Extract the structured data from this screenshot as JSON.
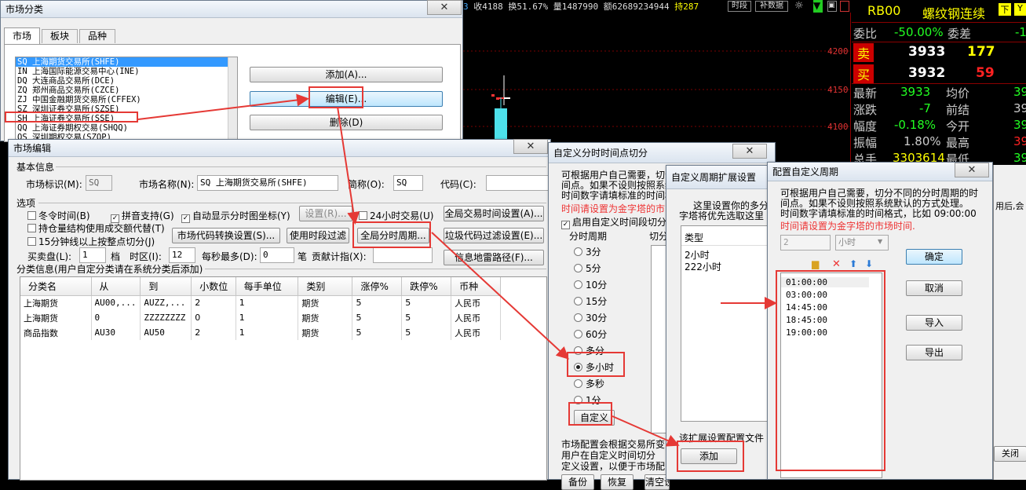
{
  "ticker": {
    "items": [
      "3",
      "收4188",
      "换51.67%",
      "量1487990",
      "额62689234944",
      "持287"
    ],
    "btn1": "时段",
    "btn2": "补数据"
  },
  "quote": {
    "code": "RB00",
    "name": "螺纹钢连续",
    "btn_x": "下",
    "btn_y": "Y",
    "rows": [
      {
        "l1": "委比",
        "v1": "-50.00%",
        "l2": "委差",
        "v2": "-1"
      },
      {
        "l1": "卖",
        "v1": "3933",
        "l2": "",
        "v2": "177"
      },
      {
        "l1": "买",
        "v1": "3932",
        "l2": "",
        "v2": "59"
      },
      {
        "l1": "最新",
        "v1": "3933",
        "l2": "均价",
        "v2": "39"
      },
      {
        "l1": "涨跌",
        "v1": "-7",
        "l2": "前结",
        "v2": "39"
      },
      {
        "l1": "幅度",
        "v1": "-0.18%",
        "l2": "今开",
        "v2": "39"
      },
      {
        "l1": "振幅",
        "v1": "1.80%",
        "l2": "最高",
        "v2": "39"
      },
      {
        "l1": "总手",
        "v1": "3303614",
        "l2": "最低",
        "v2": "39"
      }
    ],
    "price_ticks": [
      "4200",
      "4150",
      "4100"
    ]
  },
  "market_cls": {
    "title": "市场分类",
    "tabs": [
      "市场",
      "板块",
      "品种"
    ],
    "list": [
      "SQ 上海期货交易所(SHFE)",
      "IN 上海国际能源交易中心(INE)",
      "DQ 大连商品交易所(DCE)",
      "ZQ 郑州商品交易所(CZCE)",
      "ZJ 中国金融期货交易所(CFFEX)",
      "SZ 深圳证券交易所(SZSE)",
      "SH 上海证券交易所(SSE)",
      "QQ 上海证券期权交易(SHQQ)",
      "OS 深圳期权交易(SZOP)"
    ],
    "btn_add": "添加(A)...",
    "btn_edit": "编辑(E)...",
    "btn_del": "删除(D)"
  },
  "market_edit": {
    "title": "市场编辑",
    "basic": "基本信息",
    "id_label": "市场标识(M):",
    "id_val": "SQ",
    "name_label": "市场名称(N):",
    "name_val": "SQ 上海期货交易所(SHFE)",
    "short_label": "简称(O):",
    "short_val": "SQ",
    "code_label": "代码(C):",
    "options": "选项",
    "cb": [
      "冬令时间(B)",
      "拼音支持(G)",
      "自动显示分时图坐标(Y)",
      "持仓量结构使用成交额代替(T)",
      "15分钟线以上按整点切分(J)",
      "24小时交易(U)"
    ],
    "settings_btn": "设置(R)...",
    "btn_global_trade": "全局交易时间设置(A)...",
    "btn_code_conv": "市场代码转换设置(S)...",
    "btn_time_filter": "使用时段过滤",
    "btn_global_period": "全局分时周期...",
    "btn_junk": "垃圾代码过滤设置(E)...",
    "btn_info": "信息地雷路径(F)...",
    "buy_label": "买卖盘(L):",
    "buy_val": "1",
    "dang": "档",
    "tz_label": "时区(I):",
    "tz_val": "12",
    "max_label": "每秒最多(D):",
    "max_val": "0",
    "bi": "笔",
    "contrib": "贡献计指(X):",
    "cat_info": "分类信息(用户自定分类请在系统分类后添加)",
    "headers": [
      "分类名",
      "从",
      "到",
      "小数位",
      "每手单位",
      "类别",
      "涨停%",
      "跌停%",
      "币种"
    ],
    "rows": [
      [
        "上海期货",
        "AU00,...",
        "AUZZ,...",
        "2",
        "1",
        "期货",
        "5",
        "5",
        "人民币"
      ],
      [
        "上海期货",
        "0",
        "ZZZZZZZZ",
        "0",
        "1",
        "期货",
        "5",
        "5",
        "人民币"
      ],
      [
        "商品指数",
        "AU30",
        "AU50",
        "2",
        "1",
        "期货",
        "5",
        "5",
        "人民币"
      ]
    ]
  },
  "time_split": {
    "title": "自定义分时时间点切分",
    "desc1": "可根据用户自己需要，切分不",
    "desc2": "间点。如果不设则按照系统默",
    "desc3": "时间数字请填标准的时间格式",
    "red": "时间请设置为金字塔的市",
    "enable": "启用自定义时间段切分",
    "period": "分时周期",
    "cut": "切分",
    "radios": [
      "3分",
      "5分",
      "10分",
      "15分",
      "30分",
      "60分",
      "多分",
      "多小时",
      "多秒",
      "1分"
    ],
    "btn_custom": "自定义",
    "bottom1": "市场配置会根据交易所变",
    "bottom2": "用户在自定义时间切分",
    "bottom3": "定义设置，以便于市场配",
    "btn_b1": "备份",
    "btn_b2": "恢复",
    "btn_b3": "清空设置"
  },
  "ext": {
    "title": "自定义周期扩展设置",
    "d1": "这里设置你的多分",
    "d2": "字塔将优先选取这里",
    "type": "类型",
    "items": [
      "2小时",
      "222小时"
    ],
    "note": "该扩展设置配置文件",
    "btn_add": "添加"
  },
  "config": {
    "title": "配置自定义周期",
    "d1": "可根据用户自己需要，切分不同的分时周期的时",
    "d2": "间点。如果不设则按照系统默认的方式处理。",
    "d3": "时间数字请填标准的时间格式，比如 09:00:00",
    "red": "时间请设置为金字塔的市场时间.",
    "num": "2",
    "unit": "小时",
    "times": [
      "01:00:00",
      "03:00:00",
      "14:45:00",
      "18:45:00",
      "19:00:00"
    ],
    "btn_ok": "确定",
    "btn_cancel": "取消",
    "btn_import": "导入",
    "btn_export": "导出",
    "close": "关闭",
    "partial": "用后,会"
  }
}
